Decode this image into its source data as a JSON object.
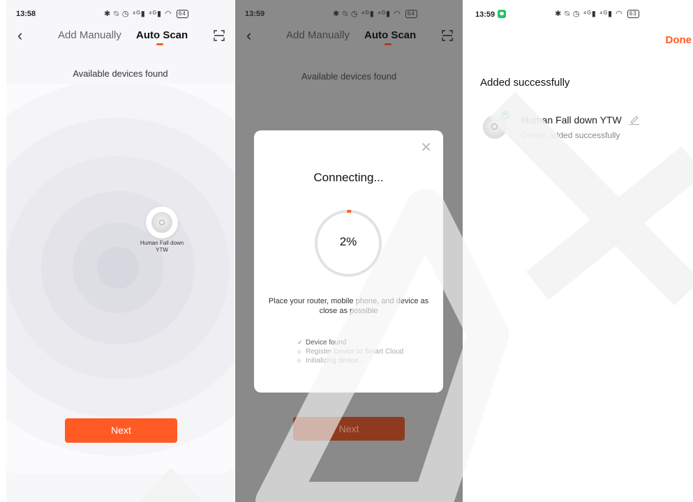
{
  "screens": [
    {
      "status": {
        "time": "13:58",
        "battery": "64"
      },
      "nav": {
        "back_icon": "chevron-left-icon",
        "tab_manual": "Add Manually",
        "tab_scan": "Auto Scan",
        "scan_icon": "scan-frame-icon"
      },
      "found_title": "Available devices found",
      "device": {
        "name": "Human Fall down YTW",
        "icon": "sensor-device-icon"
      },
      "next_label": "Next"
    },
    {
      "status": {
        "time": "13:59",
        "battery": "64"
      },
      "nav": {
        "back_icon": "chevron-left-icon",
        "tab_manual": "Add Manually",
        "tab_scan": "Auto Scan",
        "scan_icon": "scan-frame-icon"
      },
      "found_title": "Available devices found",
      "next_label": "Next",
      "modal": {
        "title": "Connecting...",
        "progress_percent": 2,
        "progress_text": "2%",
        "hint": "Place your router, mobile phone, and device as close as possible",
        "steps": [
          {
            "label": "Device found",
            "state": "done"
          },
          {
            "label": "Register Device to Smart Cloud",
            "state": "pending"
          },
          {
            "label": "Initializing device...",
            "state": "pending"
          }
        ]
      }
    },
    {
      "status": {
        "time": "13:59",
        "battery": "63"
      },
      "done_label": "Done",
      "title": "Added successfully",
      "device": {
        "name": "Human Fall down YTW",
        "subtitle": "Device added successfully",
        "icon": "sensor-device-icon"
      }
    }
  ],
  "colors": {
    "accent": "#ff5a24",
    "success": "#2ec46b",
    "watermark": "#f3f3f3"
  }
}
